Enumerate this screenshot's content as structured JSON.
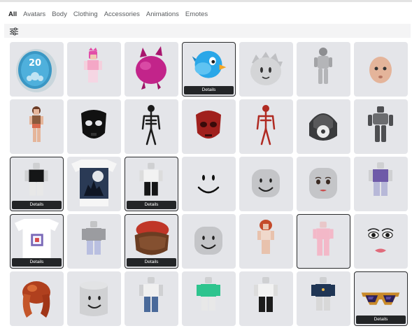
{
  "tabs": [
    {
      "label": "All",
      "active": true
    },
    {
      "label": "Avatars"
    },
    {
      "label": "Body"
    },
    {
      "label": "Clothing"
    },
    {
      "label": "Accessories"
    },
    {
      "label": "Animations"
    },
    {
      "label": "Emotes"
    }
  ],
  "filter": {
    "icon": "sliders-icon"
  },
  "details_label": "Details",
  "badge_number": "20",
  "items": [
    {
      "name": "item-20-badge",
      "details": false
    },
    {
      "name": "item-pink-avatar",
      "details": false
    },
    {
      "name": "item-magenta-creature",
      "details": false
    },
    {
      "name": "item-blue-bird",
      "details": true
    },
    {
      "name": "item-gray-spiky-head",
      "details": false
    },
    {
      "name": "item-gray-figure",
      "details": false
    },
    {
      "name": "item-bald-head",
      "details": false
    },
    {
      "name": "item-small-avatar",
      "details": false
    },
    {
      "name": "item-black-mask",
      "details": false
    },
    {
      "name": "item-black-skeleton",
      "details": false
    },
    {
      "name": "item-red-mask",
      "details": false
    },
    {
      "name": "item-red-skeleton",
      "details": false
    },
    {
      "name": "item-robot-helmet",
      "details": false
    },
    {
      "name": "item-robot-figure",
      "details": false
    },
    {
      "name": "item-black-shirt-avatar",
      "details": true
    },
    {
      "name": "item-wolf-tshirt",
      "details": false
    },
    {
      "name": "item-white-shirt-avatar",
      "details": true
    },
    {
      "name": "item-smile-face",
      "details": false
    },
    {
      "name": "item-smile-head",
      "details": false
    },
    {
      "name": "item-woman-face-head",
      "details": false
    },
    {
      "name": "item-purple-avatar",
      "details": false
    },
    {
      "name": "item-pixel-tshirt",
      "details": true
    },
    {
      "name": "item-gray-avatar",
      "details": false
    },
    {
      "name": "item-brown-hair-hat",
      "details": true
    },
    {
      "name": "item-smile-head-2",
      "details": false
    },
    {
      "name": "item-redhead-avatar",
      "details": false
    },
    {
      "name": "item-pink-outfit-avatar",
      "details": false
    },
    {
      "name": "item-lips-face",
      "details": false
    },
    {
      "name": "item-red-hair",
      "details": false
    },
    {
      "name": "item-smile-cylinder-head",
      "details": false
    },
    {
      "name": "item-jeans-avatar",
      "details": false
    },
    {
      "name": "item-green-shirt-avatar",
      "details": false
    },
    {
      "name": "item-white-shirt-avatar-2",
      "details": false
    },
    {
      "name": "item-navy-jacket-avatar",
      "details": false
    },
    {
      "name": "item-gold-sunglasses",
      "details": true
    }
  ],
  "colors": {
    "tile": "#e4e5e9",
    "details_bg": "#232527",
    "accent_blue": "#2aa7e8"
  }
}
